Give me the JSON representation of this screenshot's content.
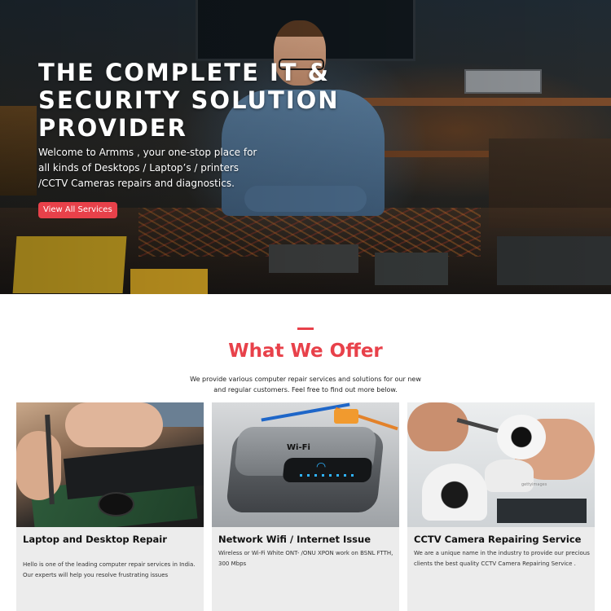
{
  "hero": {
    "title": "THE COMPLETE IT & SECURITY SOLUTION PROVIDER",
    "text": "Welcome to Armms , your one-stop place for all kinds of Desktops / Laptop’s / printers /CCTV Cameras repairs and diagnostics.",
    "button_label": "View All Services"
  },
  "offer": {
    "title": "What We Offer",
    "description": "We provide various computer repair services and solutions for our new and regular customers. Feel free to find out more below.",
    "cards": [
      {
        "title": "Laptop and Desktop Repair",
        "text": "Hello is one of the leading computer repair services in India. Our experts will help you resolve frustrating issues"
      },
      {
        "title": "Network Wifi / Internet Issue",
        "text": "Wireless or Wi-Fi White ONT- /ONU XPON work on BSNL FTTH, 300 Mbps",
        "image_label": "Wi-Fi"
      },
      {
        "title": "CCTV Camera Repairing Service",
        "text": "We are a unique name in the industry to provide our precious clients the best quality CCTV Camera Repairing Service .",
        "image_watermark": "gettyimages"
      }
    ]
  },
  "colors": {
    "accent": "#e8414a",
    "card_bg": "#ececec"
  }
}
